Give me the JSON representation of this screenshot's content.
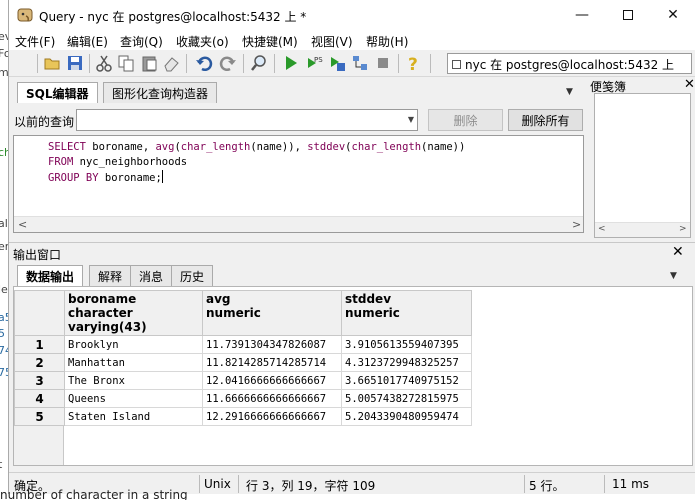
{
  "window": {
    "title": "Query - nyc 在  postgres@localhost:5432 上 *"
  },
  "menu": [
    "文件(F)",
    "编辑(E)",
    "查询(Q)",
    "收藏夹(o)",
    "快捷键(M)",
    "视图(V)",
    "帮助(H)"
  ],
  "toolbar": {
    "connection": "nyc 在  postgres@localhost:5432 上"
  },
  "sql_tabs": [
    "SQL编辑器",
    "图形化查询构造器"
  ],
  "previous_query": {
    "label": "以前的查询",
    "delete_label": "删除",
    "delete_all_label": "删除所有"
  },
  "editor": {
    "lines": [
      [
        "SELECT",
        " boroname, ",
        "avg",
        "(",
        "char_length",
        "(name)), ",
        "stddev",
        "(",
        "char_length",
        "(name))"
      ],
      [
        "FROM",
        " nyc_neighborhoods"
      ],
      [
        "GROUP BY",
        " boroname;"
      ]
    ]
  },
  "scratch_pad": {
    "title": "便笺簿"
  },
  "output": {
    "title": "输出窗口",
    "tabs": [
      "数据输出",
      "解释",
      "消息",
      "历史"
    ],
    "columns": [
      {
        "name": "boroname",
        "type": "character varying(43)"
      },
      {
        "name": "avg",
        "type": "numeric"
      },
      {
        "name": "stddev",
        "type": "numeric"
      }
    ],
    "rows": [
      [
        "1",
        "Brooklyn",
        "11.7391304347826087",
        "3.9105613559407395"
      ],
      [
        "2",
        "Manhattan",
        "11.8214285714285714",
        "4.3123729948325257"
      ],
      [
        "3",
        "The Bronx",
        "12.0416666666666667",
        "3.6651017740975152"
      ],
      [
        "4",
        "Queens",
        "11.6666666666666667",
        "5.0057438272815975"
      ],
      [
        "5",
        "Staten Island",
        "12.2916666666666667",
        "5.2043390480959474"
      ]
    ]
  },
  "status": {
    "state": "确定。",
    "line_ending": "Unix",
    "position": "行 3，列 19，字符 109",
    "rows": "5 行。",
    "time": "11 ms"
  },
  "background": {
    "left_fragments": [
      "ev",
      "Fo",
      "m",
      "ch",
      "al",
      "er",
      "le",
      "a5",
      "5",
      "74",
      "75",
      "t"
    ],
    "bottom_text": "number of character in a string"
  }
}
